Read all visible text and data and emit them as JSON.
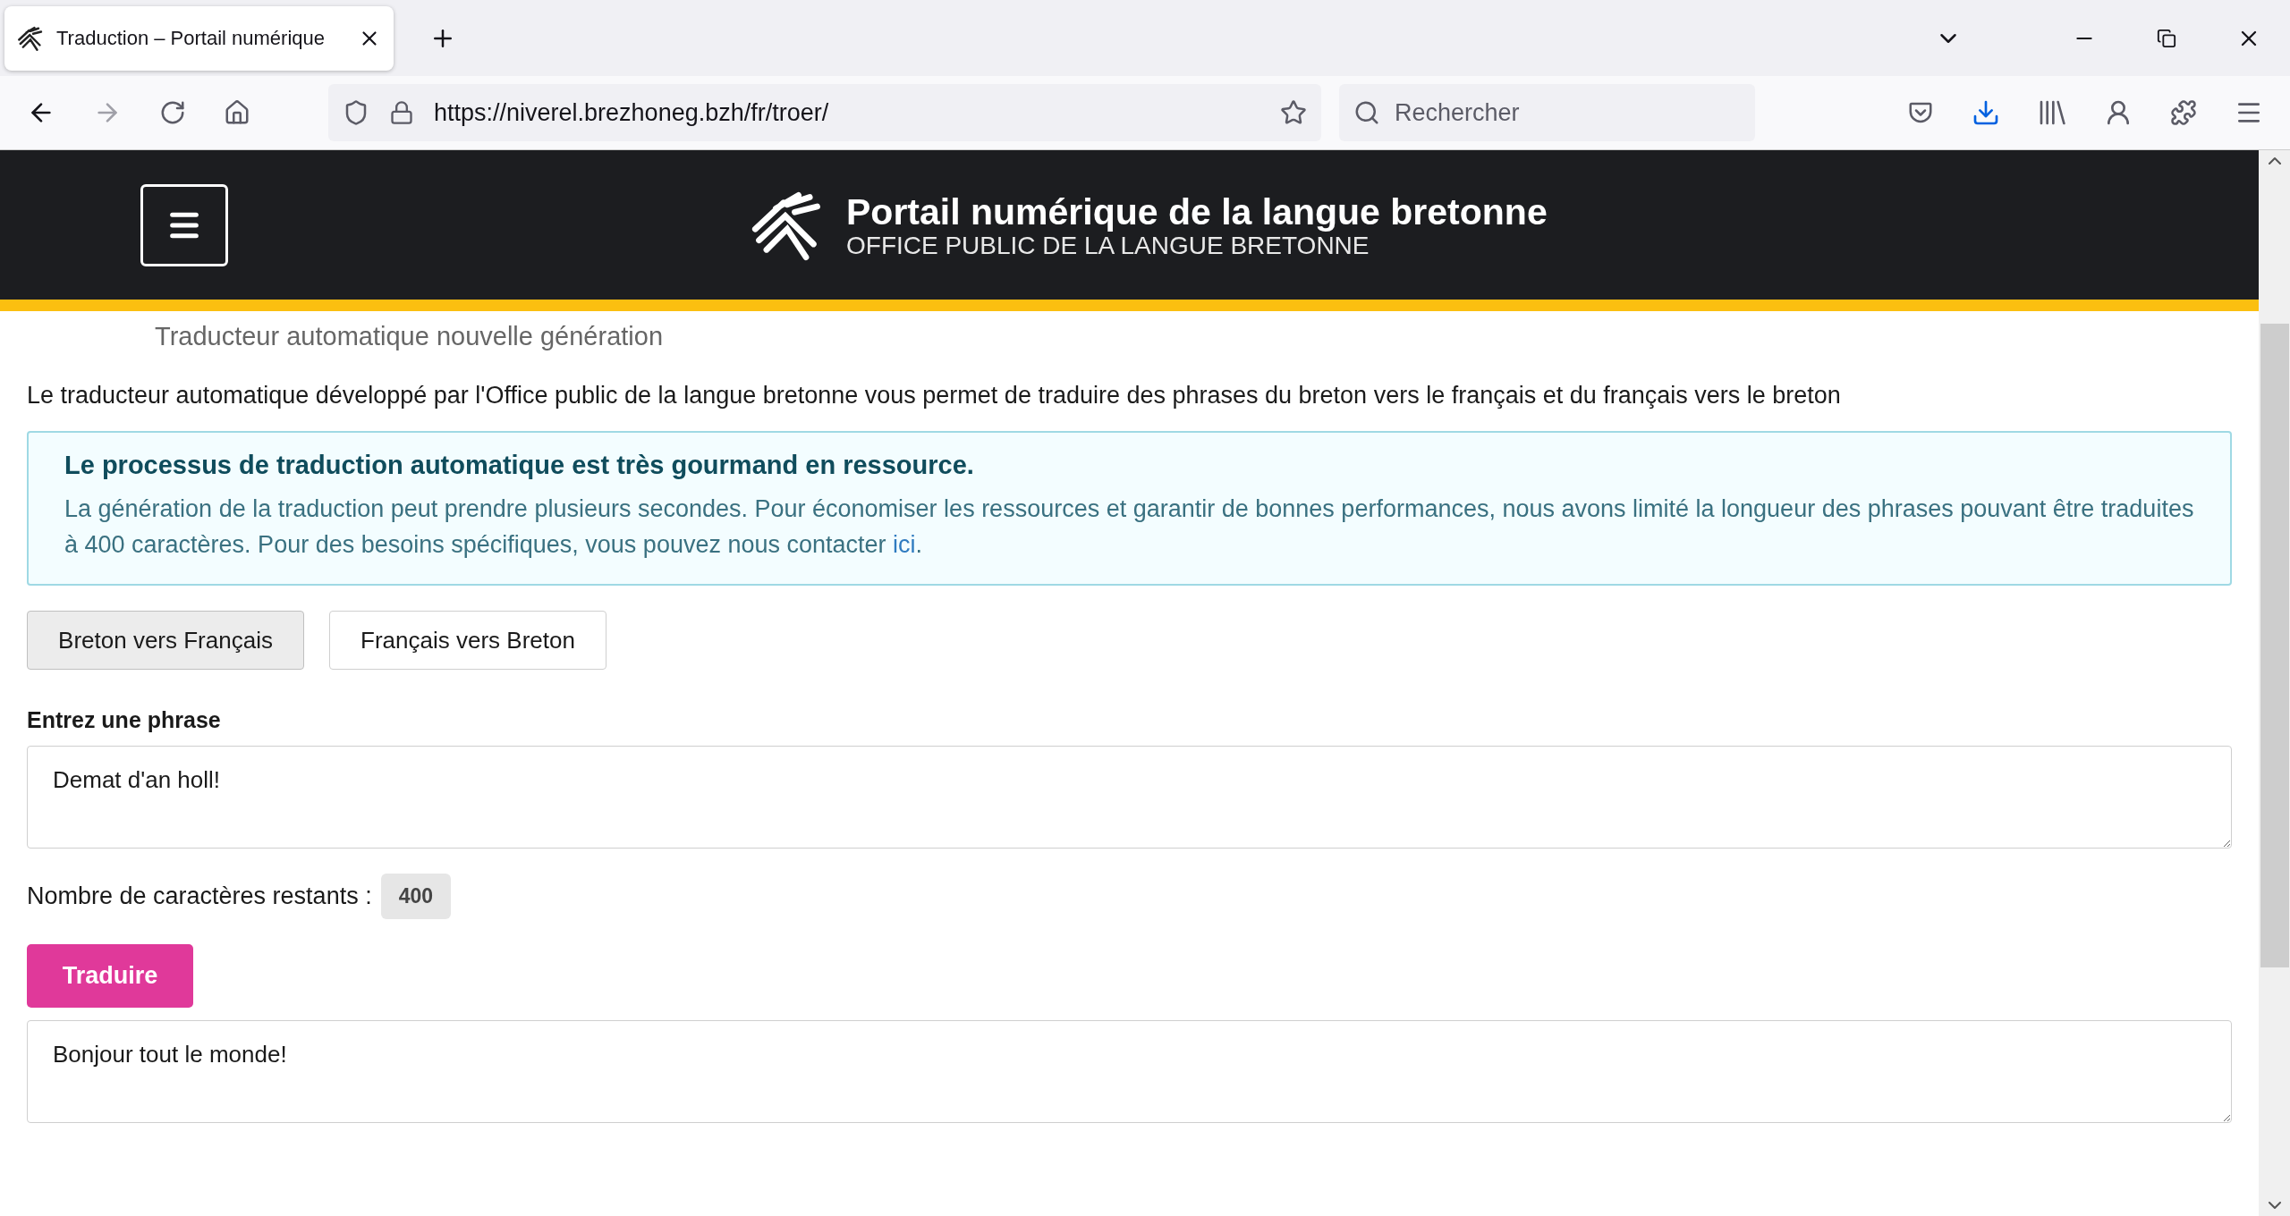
{
  "browser": {
    "tab": {
      "title": "Traduction – Portail numérique",
      "selected": true
    },
    "url": "https://niverel.brezhoneg.bzh/fr/troer/",
    "search": {
      "placeholder": "Rechercher"
    }
  },
  "header": {
    "title": "Portail numérique de la langue bretonne",
    "subtitle": "OFFICE PUBLIC DE LA LANGUE BRETONNE"
  },
  "page": {
    "heading": "Traducteur automatique nouvelle génération",
    "intro": "Le traducteur automatique développé par l'Office public de la langue bretonne vous permet de traduire des phrases du breton vers le français et du français vers le breton",
    "alert": {
      "title": "Le processus de traduction automatique est très gourmand en ressource.",
      "body": "La génération de la traduction peut prendre plusieurs secondes. Pour économiser les ressources et garantir de bonnes performances, nous avons limité la longueur des phrases pouvant être traduites à 400 caractères. Pour des besoins spécifiques, vous pouvez nous contacter ",
      "link": "ici",
      "end": "."
    },
    "modes": [
      {
        "label": "Breton vers Français",
        "selected": true
      },
      {
        "label": "Français vers Breton",
        "selected": false
      }
    ],
    "input": {
      "label": "Entrez une phrase",
      "value": "Demat d'an holl!"
    },
    "remaining": {
      "label": "Nombre de caractères restants :",
      "count": "400"
    },
    "translate_button": "Traduire",
    "output": {
      "value": "Bonjour tout le monde!"
    }
  }
}
